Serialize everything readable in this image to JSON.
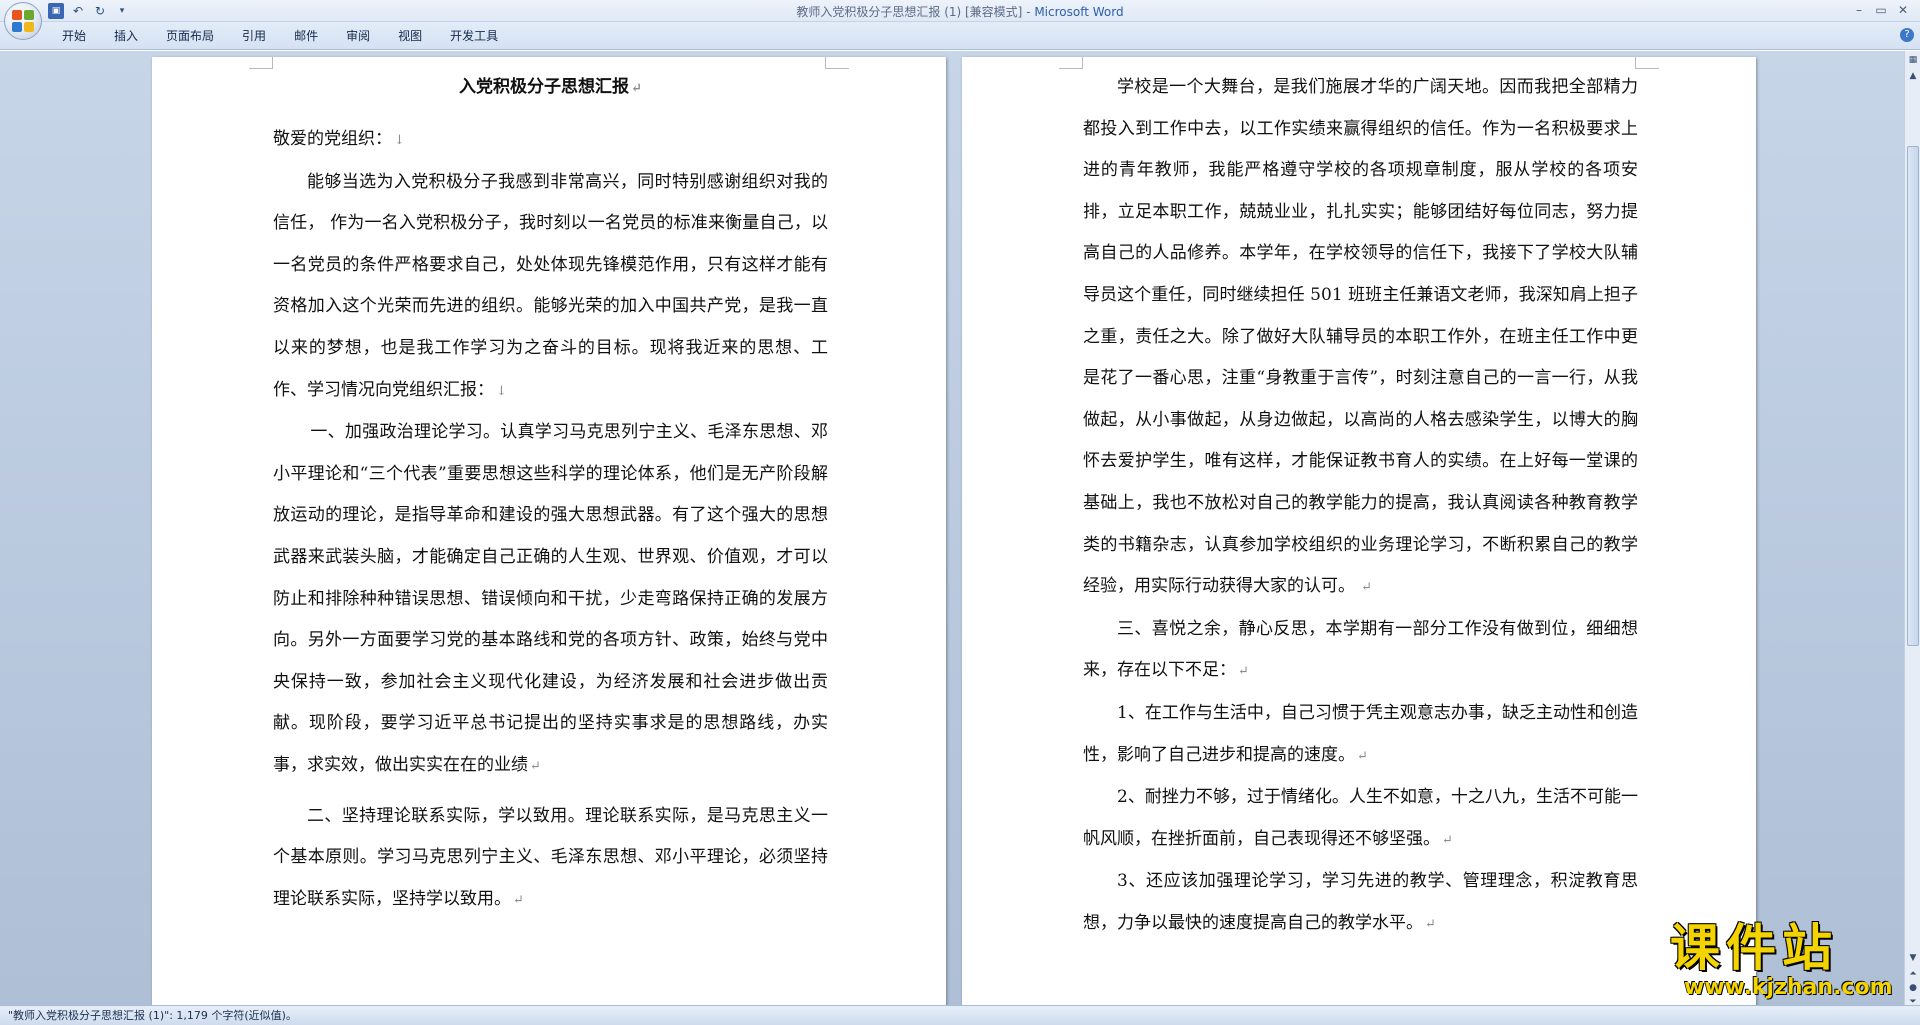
{
  "window": {
    "title": "教师入党积极分子思想汇报 (1) [兼容模式] - ",
    "app_name": "Microsoft Word"
  },
  "ribbon": {
    "tabs": [
      {
        "label": "开始"
      },
      {
        "label": "插入"
      },
      {
        "label": "页面布局"
      },
      {
        "label": "引用"
      },
      {
        "label": "邮件"
      },
      {
        "label": "审阅"
      },
      {
        "label": "视图"
      },
      {
        "label": "开发工具"
      }
    ]
  },
  "document": {
    "title": "入党积极分子思想汇报",
    "salutation": "敬爱的党组织：",
    "left_paragraphs": [
      "能够当选为入党积极分子我感到非常高兴，同时特别感谢组织对我的信任， 作为一名入党积极分子，我时刻以一名党员的标准来衡量自己，以一名党员的条件严格要求自己，处处体现先锋模范作用，只有这样才能有资格加入这个光荣而先进的组织。能够光荣的加入中国共产党，是我一直以来的梦想，也是我工作学习为之奋斗的目标。现将我近来的思想、工作、学习情况向党组织汇报：",
      "一、加强政治理论学习。认真学习马克思列宁主义、毛泽东思想、邓小平理论和“三个代表”重要思想这些科学的理论体系，他们是无产阶段解放运动的理论，是指导革命和建设的强大思想武器。有了这个强大的思想武器来武装头脑，才能确定自己正确的人生观、世界观、价值观，才可以防止和排除种种错误思想、错误倾向和干扰，少走弯路保持正确的发展方向。另外一方面要学习党的基本路线和党的各项方针、政策，始终与党中央保持一致，参加社会主义现代化建设，为经济发展和社会进步做出贡献。现阶段，要学习近平总书记提出的坚持实事求是的思想路线，办实事，求实效，做出实实在在的业绩",
      "二、坚持理论联系实际，学以致用。理论联系实际，是马克思主义一个基本原则。学习马克思列宁主义、毛泽东思想、邓小平理论，必须坚持理论联系实际，坚持学以致用。"
    ],
    "right_paragraphs": [
      "学校是一个大舞台，是我们施展才华的广阔天地。因而我把全部精力都投入到工作中去，以工作实绩来赢得组织的信任。作为一名积极要求上进的青年教师，我能严格遵守学校的各项规章制度，服从学校的各项安排，立足本职工作，兢兢业业，扎扎实实；能够团结好每位同志，努力提高自己的人品修养。本学年，在学校领导的信任下，我接下了学校大队辅导员这个重任，同时继续担任 501 班班主任兼语文老师，我深知肩上担子之重，责任之大。除了做好大队辅导员的本职工作外，在班主任工作中更是花了一番心思，注重“身教重于言传”，时刻注意自己的一言一行，从我做起，从小事做起，从身边做起，以高尚的人格去感染学生，以博大的胸怀去爱护学生，唯有这样，才能保证教书育人的实绩。在上好每一堂课的基础上，我也不放松对自己的教学能力的提高，我认真阅读各种教育教学类的书籍杂志，认真参加学校组织的业务理论学习，不断积累自己的教学经验，用实际行动获得大家的认可。",
      "三、喜悦之余，静心反思，本学期有一部分工作没有做到位，细细想来，存在以下不足：",
      "1、在工作与生活中，自己习惯于凭主观意志办事，缺乏主动性和创造性，影响了自己进步和提高的速度。",
      "2、耐挫力不够，过于情绪化。人生不如意，十之八九，生活不可能一帆风顺，在挫折面前，自己表现得还不够坚强。",
      "3、还应该加强理论学习，学习先进的教学、管理理念，积淀教育思想，力争以最快的速度提高自己的教学水平。"
    ]
  },
  "status": {
    "text": "\"教师入党积极分子思想汇报 (1)\": 1,179 个字符(近似值)。"
  },
  "watermark": {
    "name": "课件站",
    "url": "www.kjzhan.com"
  },
  "colors": {
    "workspace": "#b9c9df",
    "watermark": "#f4d400",
    "app_name": "#2d5ea8"
  }
}
